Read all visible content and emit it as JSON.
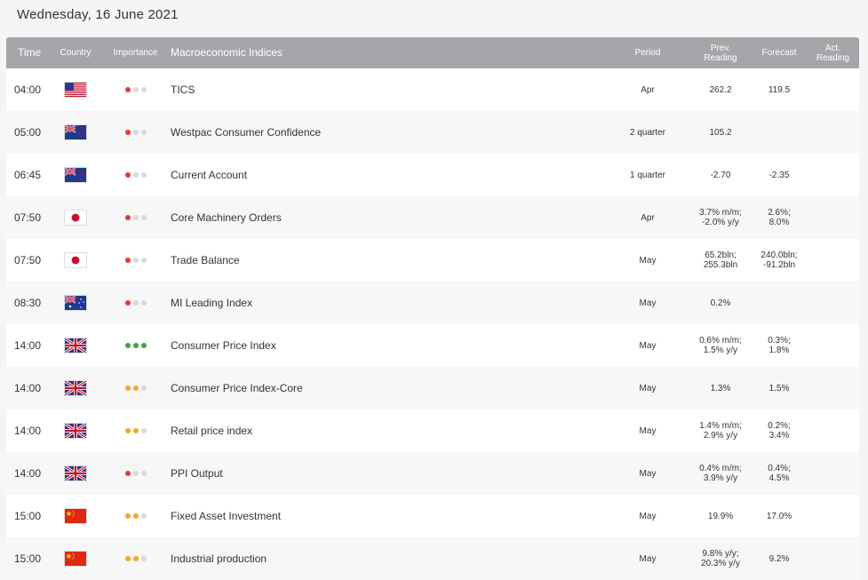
{
  "date_title": "Wednesday, 16 June 2021",
  "colors": {
    "header_bg": "#a5a6a9",
    "importance_high": "#e53935",
    "importance_green": "#43a047",
    "importance_orange": "#f5a623",
    "importance_empty": "#d9d9d9"
  },
  "columns": {
    "time": "Time",
    "country": "Country",
    "importance": "Importance",
    "indices": "Macroeconomic Indices",
    "period": "Period",
    "prev": "Prev. Reading",
    "forecast": "Forecast",
    "actual": "Act. Reading"
  },
  "rows": [
    {
      "time": "04:00",
      "country": "us-flag",
      "importance": [
        "red",
        "empty",
        "empty"
      ],
      "name": "TICS",
      "period": "Apr",
      "prev": "262.2",
      "forecast": "119.5",
      "actual": ""
    },
    {
      "time": "05:00",
      "country": "nz-flag",
      "importance": [
        "red",
        "empty",
        "empty"
      ],
      "name": "Westpac Consumer Confidence",
      "period": "2 quarter",
      "prev": "105.2",
      "forecast": "",
      "actual": ""
    },
    {
      "time": "06:45",
      "country": "nz-flag",
      "importance": [
        "red",
        "empty",
        "empty"
      ],
      "name": "Current Account",
      "period": "1 quarter",
      "prev": "-2.70",
      "forecast": "-2.35",
      "actual": ""
    },
    {
      "time": "07:50",
      "country": "jp-flag",
      "importance": [
        "red",
        "empty",
        "empty"
      ],
      "name": "Core Machinery Orders",
      "period": "Apr",
      "prev": "3.7% m/m;\n-2.0% y/y",
      "forecast": "2.6%;\n8.0%",
      "actual": ""
    },
    {
      "time": "07:50",
      "country": "jp-flag",
      "importance": [
        "red",
        "empty",
        "empty"
      ],
      "name": "Trade Balance",
      "period": "May",
      "prev": "65.2bln;\n255.3bln",
      "forecast": "240.0bln;\n-91.2bln",
      "actual": ""
    },
    {
      "time": "08:30",
      "country": "au-flag",
      "importance": [
        "red",
        "empty",
        "empty"
      ],
      "name": "MI Leading Index",
      "period": "May",
      "prev": "0.2%",
      "forecast": "",
      "actual": ""
    },
    {
      "time": "14:00",
      "country": "uk-flag",
      "importance": [
        "green",
        "green",
        "green"
      ],
      "name": "Consumer Price Index",
      "period": "May",
      "prev": "0.6% m/m;\n1.5% y/y",
      "forecast": "0.3%;\n1.8%",
      "actual": ""
    },
    {
      "time": "14:00",
      "country": "uk-flag",
      "importance": [
        "orange",
        "orange",
        "empty"
      ],
      "name": "Consumer Price Index-Core",
      "period": "May",
      "prev": "1.3%",
      "forecast": "1.5%",
      "actual": ""
    },
    {
      "time": "14:00",
      "country": "uk-flag",
      "importance": [
        "orange",
        "orange",
        "empty"
      ],
      "name": "Retail price index",
      "period": "May",
      "prev": "1.4% m/m;\n2.9% y/y",
      "forecast": "0.2%;\n3.4%",
      "actual": ""
    },
    {
      "time": "14:00",
      "country": "uk-flag",
      "importance": [
        "red",
        "empty",
        "empty"
      ],
      "name": "PPI Output",
      "period": "May",
      "prev": "0.4% m/m;\n3.9% y/y",
      "forecast": "0.4%;\n4.5%",
      "actual": ""
    },
    {
      "time": "15:00",
      "country": "cn-flag",
      "importance": [
        "orange",
        "orange",
        "empty"
      ],
      "name": "Fixed Asset Investment",
      "period": "May",
      "prev": "19.9%",
      "forecast": "17.0%",
      "actual": ""
    },
    {
      "time": "15:00",
      "country": "cn-flag",
      "importance": [
        "orange",
        "orange",
        "empty"
      ],
      "name": "Industrial production",
      "period": "May",
      "prev": "9.8% y/y;\n20.3% y/y",
      "forecast": "9.2%",
      "actual": ""
    }
  ]
}
